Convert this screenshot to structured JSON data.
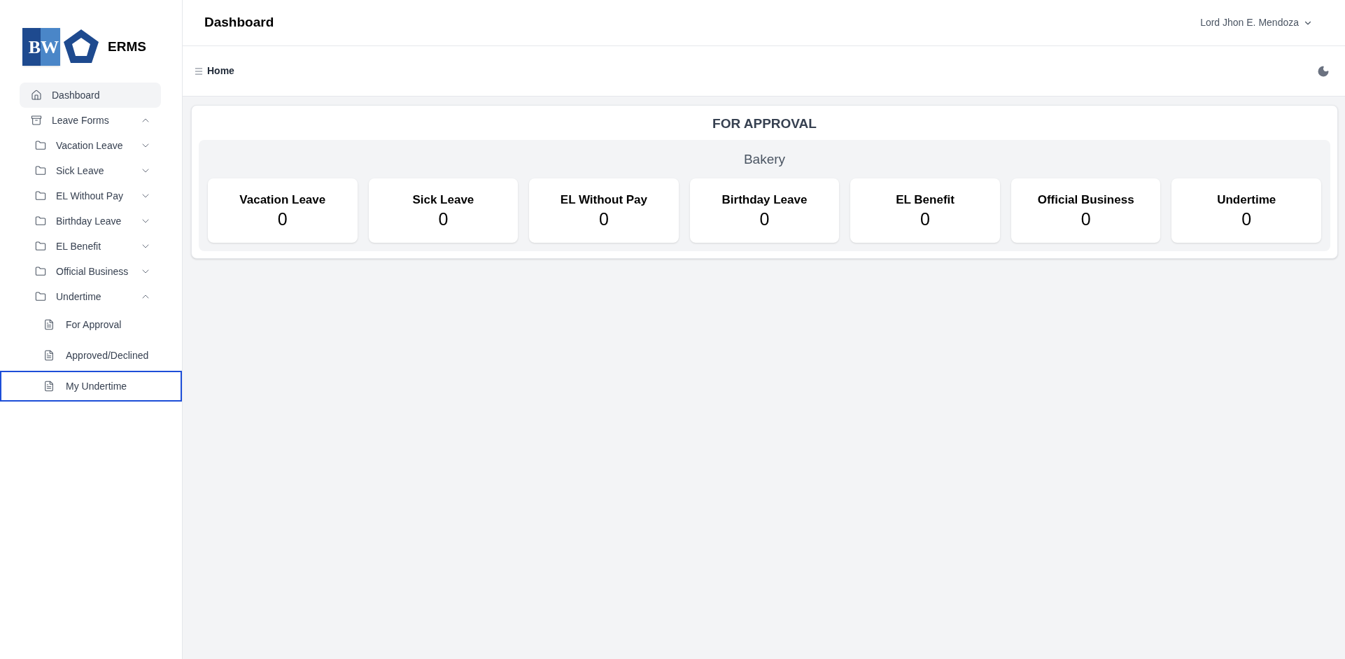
{
  "sidebar": {
    "brand": {
      "logo_text": "BW",
      "title": "ERMS"
    },
    "items": [
      {
        "label": "Dashboard",
        "kind": "link",
        "selected": true,
        "focused": false
      },
      {
        "label": "Leave Forms",
        "kind": "group",
        "selected": false,
        "focused": false,
        "expanded": true,
        "children": [
          {
            "label": "Vacation Leave",
            "kind": "folder",
            "selected": false,
            "focused": false,
            "expanded": false
          },
          {
            "label": "Sick Leave",
            "kind": "folder",
            "selected": false,
            "focused": false,
            "expanded": false
          },
          {
            "label": "EL Without Pay",
            "kind": "folder",
            "selected": false,
            "focused": false,
            "expanded": false
          },
          {
            "label": "Birthday Leave",
            "kind": "folder",
            "selected": false,
            "focused": false,
            "expanded": false
          },
          {
            "label": "EL Benefit",
            "kind": "folder",
            "selected": false,
            "focused": false,
            "expanded": false
          },
          {
            "label": "Official Business",
            "kind": "folder",
            "selected": false,
            "focused": false,
            "expanded": false
          },
          {
            "label": "Undertime",
            "kind": "folder",
            "selected": false,
            "focused": false,
            "expanded": true,
            "children": [
              {
                "label": "For Approval",
                "kind": "page",
                "selected": false,
                "focused": false
              },
              {
                "label": "Approved/Declined",
                "kind": "page",
                "selected": false,
                "focused": false
              },
              {
                "label": "My Undertime",
                "kind": "page",
                "selected": false,
                "focused": true
              }
            ]
          }
        ]
      }
    ]
  },
  "header": {
    "title": "Dashboard",
    "user": "Lord Jhon E. Mendoza"
  },
  "breadcrumb": {
    "label": "Home"
  },
  "panel": {
    "title": "FOR APPROVAL",
    "section": "Bakery",
    "cards": [
      {
        "label": "Vacation Leave",
        "value": "0"
      },
      {
        "label": "Sick Leave",
        "value": "0"
      },
      {
        "label": "EL Without Pay",
        "value": "0"
      },
      {
        "label": "Birthday Leave",
        "value": "0"
      },
      {
        "label": "EL Benefit",
        "value": "0"
      },
      {
        "label": "Official Business",
        "value": "0"
      },
      {
        "label": "Undertime",
        "value": "0"
      }
    ]
  }
}
